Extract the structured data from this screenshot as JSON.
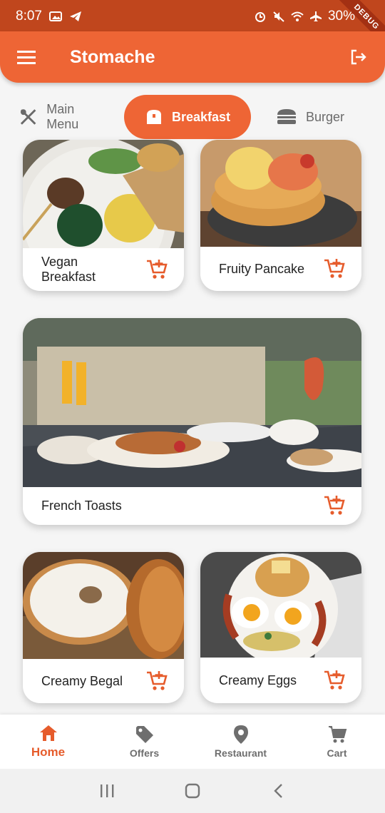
{
  "status_bar": {
    "time": "8:07",
    "battery": "30%",
    "debug": "DEBUG"
  },
  "app_bar": {
    "title": "Stomache"
  },
  "categories": [
    {
      "label": "Main Menu",
      "icon": "cutlery-icon",
      "active": false
    },
    {
      "label": "Breakfast",
      "icon": "bread-icon",
      "active": true
    },
    {
      "label": "Burger",
      "icon": "burger-icon",
      "active": false
    }
  ],
  "cards": [
    {
      "label": "Vegan\nBreakfast",
      "image": "vegan-breakfast-photo"
    },
    {
      "label": "Fruity Pancake",
      "image": "fruity-pancake-photo"
    },
    {
      "label": "French Toasts",
      "image": "french-toasts-photo"
    },
    {
      "label": "Creamy Begal",
      "image": "creamy-bagel-photo"
    },
    {
      "label": "Creamy Eggs",
      "image": "creamy-eggs-photo"
    }
  ],
  "bottom_nav": [
    {
      "label": "Home",
      "icon": "home-icon",
      "active": true
    },
    {
      "label": "Offers",
      "icon": "tag-icon",
      "active": false
    },
    {
      "label": "Restaurant",
      "icon": "location-pin-icon",
      "active": false
    },
    {
      "label": "Cart",
      "icon": "cart-icon",
      "active": false
    }
  ],
  "colors": {
    "accent": "#ee6535",
    "status": "#c0461d",
    "nav_active": "#e65c2c"
  }
}
